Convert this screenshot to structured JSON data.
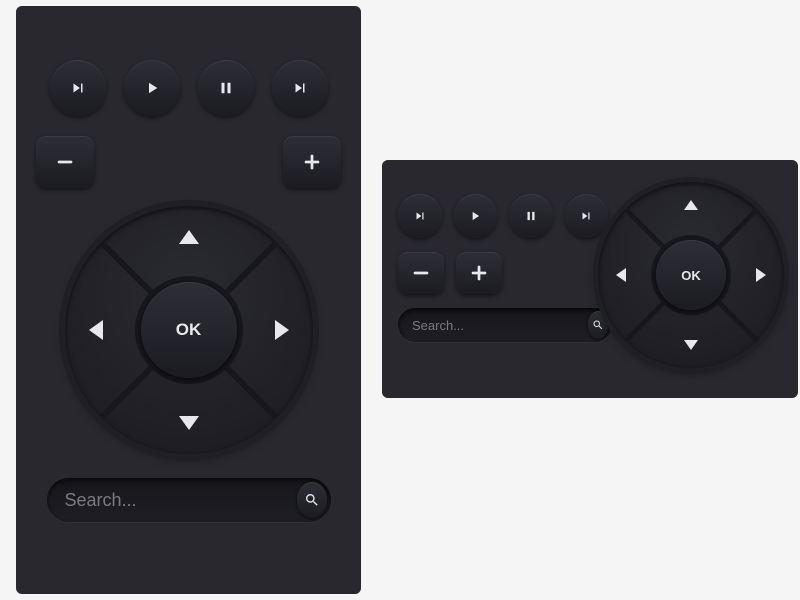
{
  "large": {
    "ok_label": "OK",
    "search_placeholder": "Search..."
  },
  "small": {
    "ok_label": "OK",
    "search_placeholder": "Search..."
  },
  "icons": {
    "prev": "skip-back-icon",
    "play": "play-icon",
    "pause": "pause-icon",
    "next": "skip-forward-icon",
    "minus": "minus-icon",
    "plus": "plus-icon",
    "search": "search-icon"
  }
}
